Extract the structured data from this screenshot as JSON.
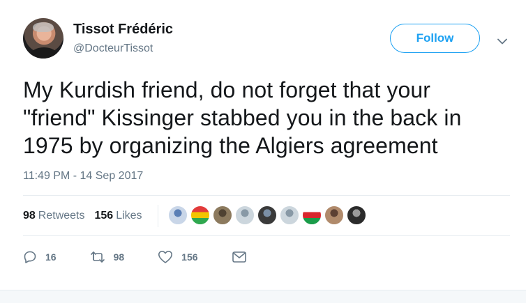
{
  "author": {
    "name": "Tissot Frédéric",
    "handle": "@DocteurTissot"
  },
  "follow_label": "Follow",
  "tweet_text": "My Kurdish friend, do not forget that your \"friend\" Kissinger stabbed you in the back in 1975 by organizing the Algiers agreement",
  "timestamp": "11:49 PM - 14 Sep 2017",
  "stats": {
    "retweets_count": "98",
    "retweets_label": "Retweets",
    "likes_count": "156",
    "likes_label": "Likes"
  },
  "liker_avatars": [
    {
      "name": "avatar-1",
      "colors": [
        "#c9d6e8",
        "#5b7fb5"
      ]
    },
    {
      "name": "avatar-2",
      "colors": [
        "#e23b3b",
        "#2fa84f",
        "#f2c500"
      ]
    },
    {
      "name": "avatar-3",
      "colors": [
        "#8c7a5e",
        "#4f4232"
      ]
    },
    {
      "name": "avatar-4",
      "colors": [
        "#ccd6dd",
        "#8899a6"
      ]
    },
    {
      "name": "avatar-5",
      "colors": [
        "#3a3a3a",
        "#7b8fa6"
      ]
    },
    {
      "name": "avatar-6",
      "colors": [
        "#ccd6dd",
        "#8899a6"
      ]
    },
    {
      "name": "avatar-7",
      "colors": [
        "#ffffff",
        "#1a9c4a",
        "#d8262d"
      ]
    },
    {
      "name": "avatar-8",
      "colors": [
        "#b08a6b",
        "#5c4033"
      ]
    },
    {
      "name": "avatar-9",
      "colors": [
        "#2b2b2b",
        "#9a9a9a"
      ]
    }
  ],
  "actions": {
    "replies": "16",
    "retweets": "98",
    "likes": "156"
  },
  "colors": {
    "accent": "#1da1f2",
    "secondary_text": "#657786",
    "primary_text": "#14171a",
    "divider": "#e6ecf0"
  }
}
